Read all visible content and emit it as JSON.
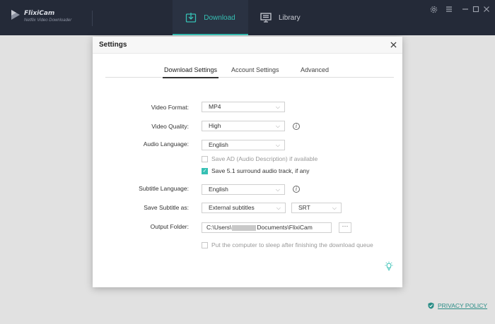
{
  "app": {
    "brand": "FlixiCam",
    "subtitle": "Netflix Video Downloader"
  },
  "nav": {
    "download_label": "Download",
    "library_label": "Library"
  },
  "window_controls": {
    "settings_icon": "gear-icon",
    "menu_icon": "hamburger-icon",
    "minimize": "—",
    "maximize": "☐",
    "close": "✕"
  },
  "dialog": {
    "title": "Settings",
    "close": "✕",
    "tabs": [
      "Download Settings",
      "Account Settings",
      "Advanced"
    ],
    "fields": {
      "video_format_label": "Video Format:",
      "video_format_value": "MP4",
      "video_quality_label": "Video Quality:",
      "video_quality_value": "High",
      "audio_language_label": "Audio Language:",
      "audio_language_value": "English",
      "save_ad_label": "Save AD (Audio Description) if available",
      "save_51_label": "Save 5.1 surround audio track, if any",
      "subtitle_language_label": "Subtitle Language:",
      "subtitle_language_value": "English",
      "save_subtitle_label": "Save Subtitle as:",
      "save_subtitle_value": "External subtitles",
      "subtitle_format_value": "SRT",
      "output_folder_label": "Output Folder:",
      "output_folder_prefix": "C:\\Users\\",
      "output_folder_suffix": "Documents\\FlixiCam",
      "browse_label": "···",
      "sleep_label": "Put the computer to sleep after finishing the download queue"
    },
    "checks": {
      "save_ad": false,
      "save_51": true,
      "sleep": false
    }
  },
  "footer": {
    "privacy_label": "PRIVACY POLICY"
  },
  "colors": {
    "accent": "#36c0b4",
    "topbar": "#242a38",
    "overlay": "#e1e1e1"
  }
}
